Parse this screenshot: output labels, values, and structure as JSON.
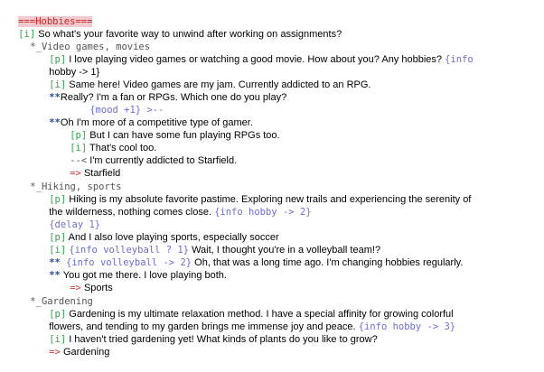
{
  "script": {
    "header": "===Hobbies===",
    "tag_i": "[i]",
    "tag_p": "[p]",
    "arrow": "=>",
    "line1": " So what's your favorite way to unwind after working on assignments?",
    "cat1": "*_Video games, movies",
    "l_vg1": " I love playing video games or watching a good movie. How about you? Any hobbies? ",
    "l_vg1_info": "{info",
    "l_vg1_cont": "hobby -> 1}",
    "l_vg2": " Same here! Video games are my jam. Currently addicted to an RPG.",
    "l_vg3_star": "**",
    "l_vg3": "Really? I'm a fan or RPGs. Which one do you play?",
    "l_vg4": "{mood +1} >--",
    "l_vg5_star": "**",
    "l_vg5": "Oh I'm more of a competitive type of gamer.",
    "l_vg6": " But I can have some fun playing RPGs too.",
    "l_vg7": " That's cool too.",
    "l_vg8_mark": "--<",
    "l_vg8": " I'm currently addicted to Starfield.",
    "l_vg9": " Starfield",
    "cat2": "*_Hiking, sports",
    "l_hk1": " Hiking is my absolute favorite pastime. Exploring new trails and experiencing the serenity of",
    "l_hk1_cont": "the wilderness, nothing comes close. ",
    "l_hk1_info": "{info hobby -> 2}",
    "l_hk2": "{delay 1}",
    "l_hk3": " And I also love playing sports, especially soccer",
    "l_hk4_info": "{info volleyball ? 1}",
    "l_hk4": " Wait, I thought you're in a volleyball team!?",
    "l_hk5_star": "**",
    "l_hk5_info": "{info volleyball -> 2}",
    "l_hk5": " Oh, that was a long time ago. I'm changing hobbies regularly.",
    "l_hk6_star": "**",
    "l_hk6": " You got me there. I love playing both.",
    "l_hk7": " Sports",
    "cat3": "*_Gardening",
    "l_gd1": " Gardening is my ultimate relaxation method. I have a special affinity for growing colorful",
    "l_gd1_cont": "flowers, and tending to my garden brings me immense joy and peace. ",
    "l_gd1_info": "{info hobby -> 3}",
    "l_gd2": " I haven't tried gardening yet! What kinds of plants do you like to grow?",
    "l_gd3": " Gardening"
  },
  "colors": {
    "tag": "#2ea34b",
    "info": "#6d6dd1",
    "star": "#2449b8",
    "arrow": "#d43a3a",
    "header": "#cc2222"
  }
}
